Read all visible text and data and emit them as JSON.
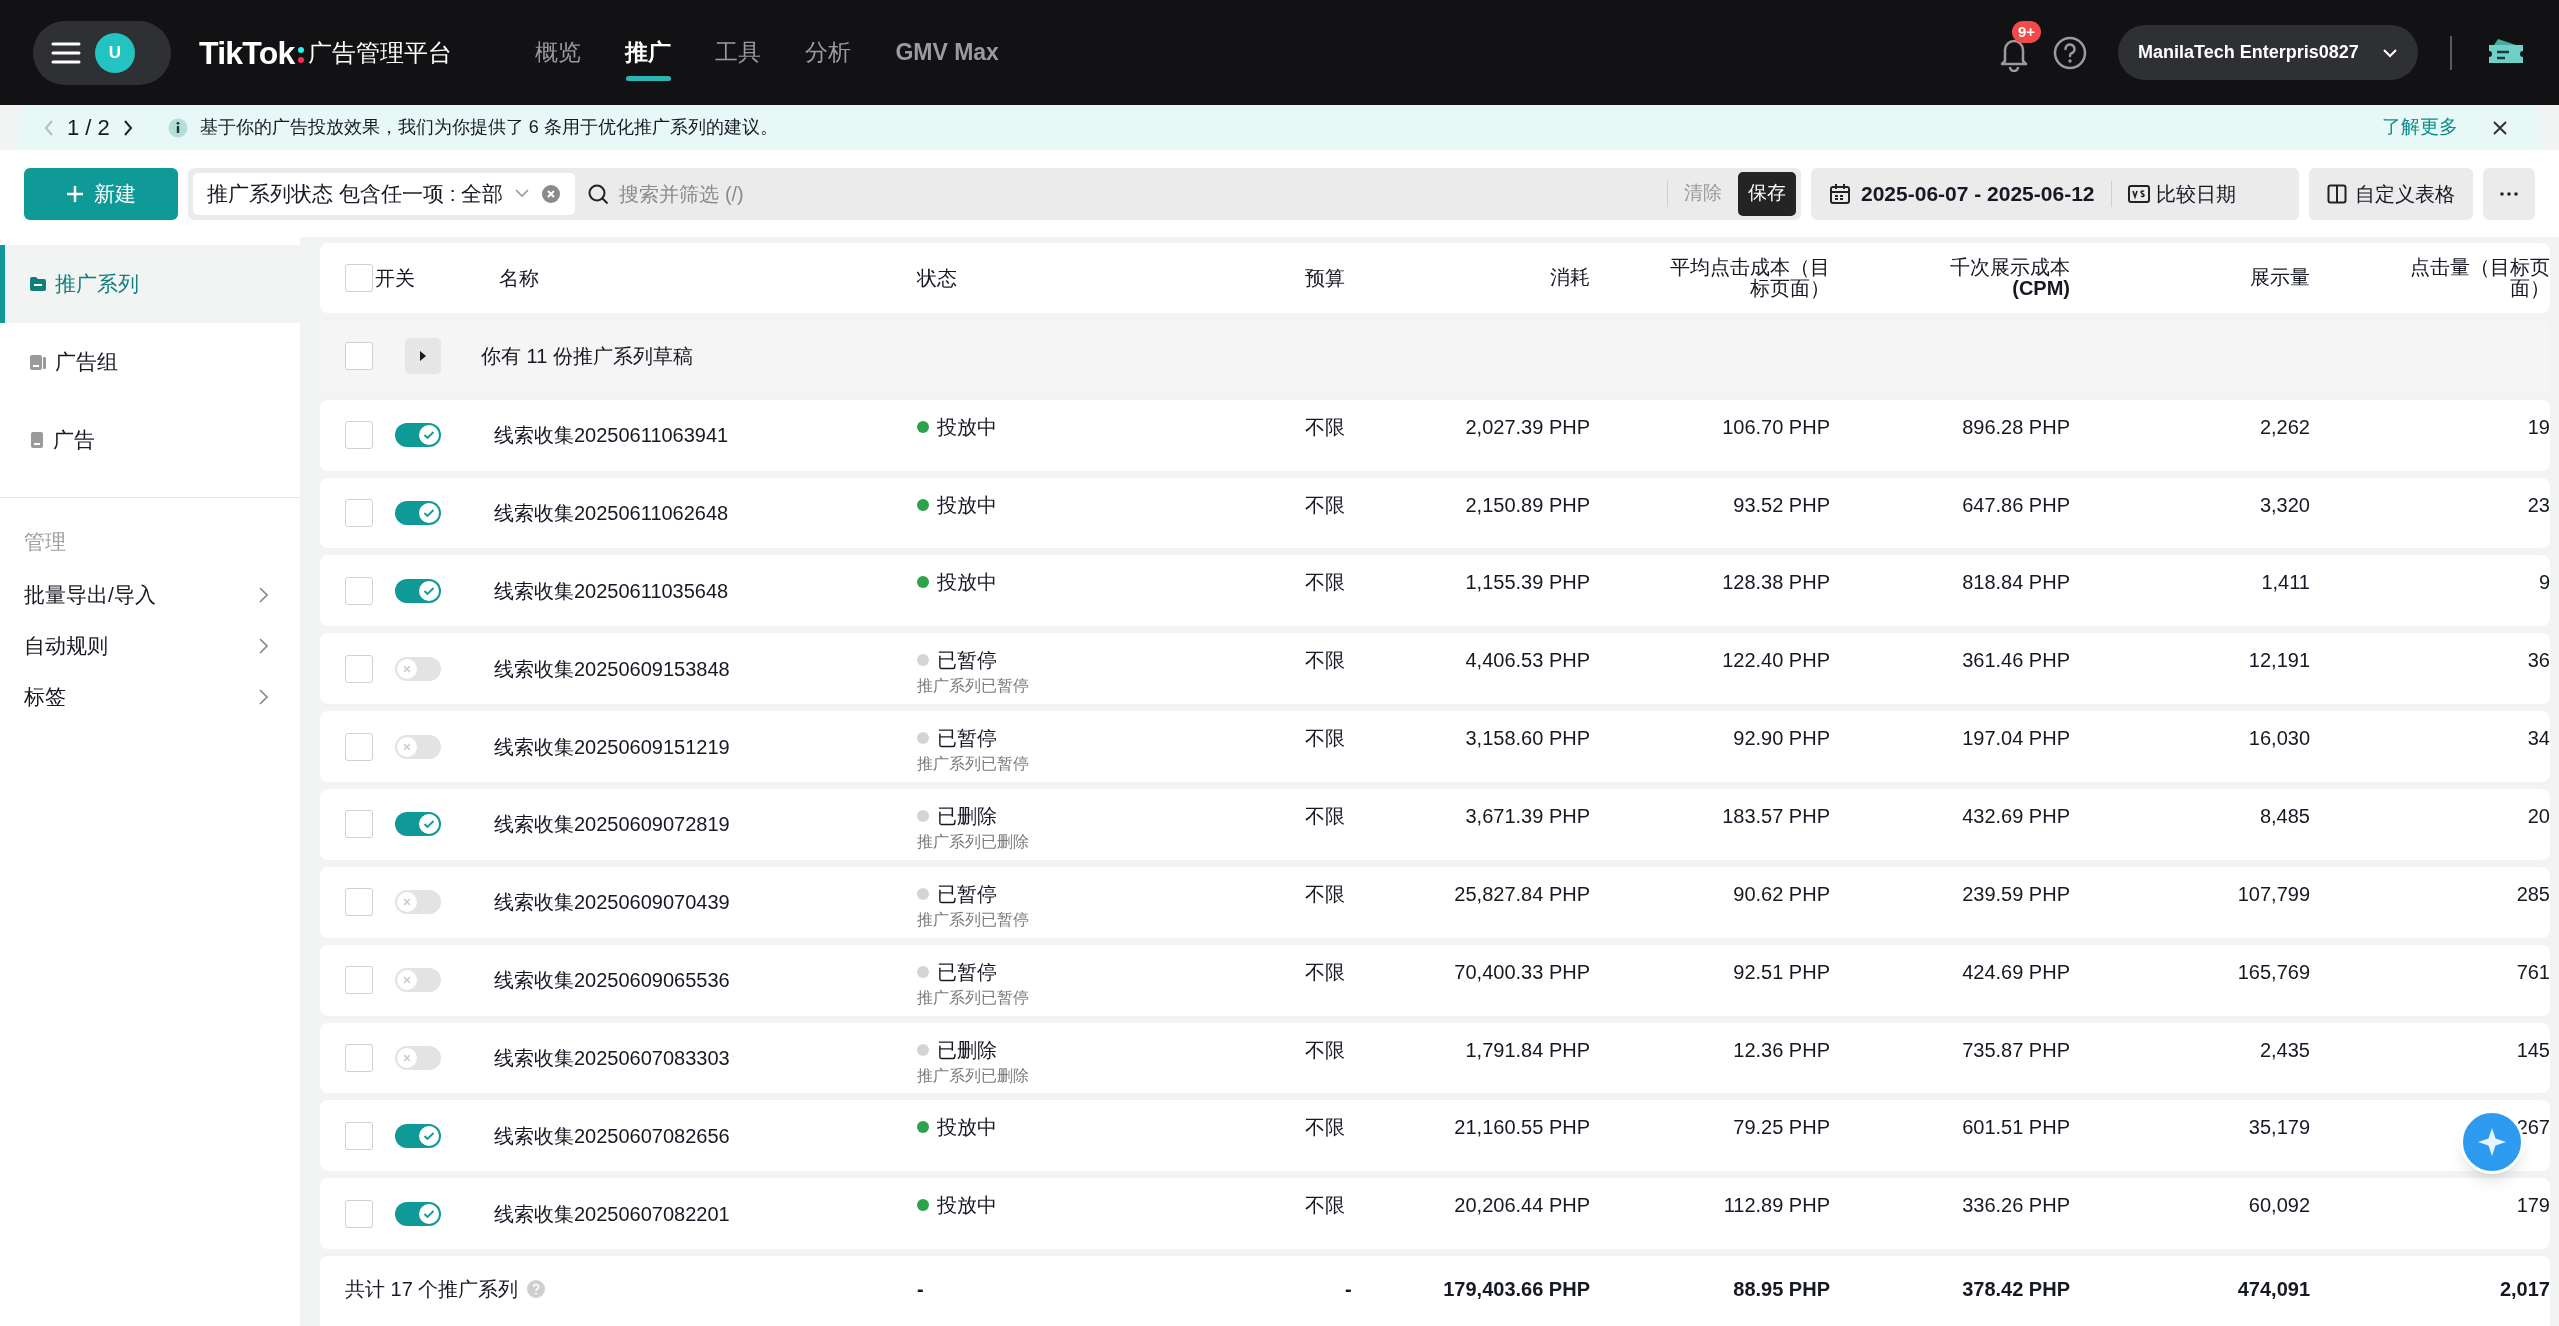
{
  "top_bar": {
    "avatar": "U",
    "logo": "TikTok",
    "logo_suffix": "广告管理平台",
    "nav": [
      {
        "label": "概览",
        "selected": false
      },
      {
        "label": "推广",
        "selected": true
      },
      {
        "label": "工具",
        "selected": false
      },
      {
        "label": "分析",
        "selected": false
      },
      {
        "label": "GMV Max",
        "selected": false
      }
    ],
    "notification_badge": "9+",
    "account": "ManilaTech Enterpris0827"
  },
  "banner": {
    "pager": "1 / 2",
    "message": "基于你的广告投放效果，我们为你提供了 6 条用于优化推广系列的建议。",
    "link": "了解更多"
  },
  "toolbar": {
    "new_button": "新建",
    "filter": "推广系列状态 包含任一项 : 全部",
    "search": {
      "placeholder": "搜索并筛选 (/)"
    },
    "clear": "清除",
    "save": "保存",
    "date_range": "2025-06-07 - 2025-06-12",
    "compare": "比较日期",
    "customize": "自定义表格"
  },
  "sidebar": {
    "items": [
      {
        "label": "推广系列",
        "selected": true
      },
      {
        "label": "广告组",
        "selected": false
      },
      {
        "label": "广告",
        "selected": false
      }
    ],
    "section": "管理",
    "menu": [
      "批量导出/导入",
      "自动规则",
      "标签"
    ]
  },
  "table": {
    "select_all_checked": false,
    "draft_checked": false,
    "columns": [
      "开关",
      "名称",
      "状态",
      "预算",
      "消耗",
      "平均点击成本（目标页面）",
      "千次展示成本 **(CPM)**",
      "展示量",
      "点击量（目标页面）"
    ],
    "draft_row": "你有 11 份推广系列草稿",
    "rows": [
      {
        "checked": false,
        "on": true,
        "name": "线索收集20250611063941",
        "status": "投放中",
        "color": "#2ba34a",
        "budget": "不限",
        "spend": "2,027.39 PHP",
        "cpc": "106.70 PHP",
        "cpm": "896.28 PHP",
        "impressions": "2,262",
        "clicks": "19"
      },
      {
        "checked": false,
        "on": true,
        "name": "线索收集20250611062648",
        "status": "投放中",
        "color": "#2ba34a",
        "budget": "不限",
        "spend": "2,150.89 PHP",
        "cpc": "93.52 PHP",
        "cpm": "647.86 PHP",
        "impressions": "3,320",
        "clicks": "23"
      },
      {
        "checked": false,
        "on": true,
        "name": "线索收集20250611035648",
        "status": "投放中",
        "color": "#2ba34a",
        "budget": "不限",
        "spend": "1,155.39 PHP",
        "cpc": "128.38 PHP",
        "cpm": "818.84 PHP",
        "impressions": "1,411",
        "clicks": "9"
      },
      {
        "checked": false,
        "on": false,
        "name": "线索收集20250609153848",
        "status": "已暂停",
        "color": "#d4d4d4",
        "status_note": "推广系列已暂停",
        "budget": "不限",
        "spend": "4,406.53 PHP",
        "cpc": "122.40 PHP",
        "cpm": "361.46 PHP",
        "impressions": "12,191",
        "clicks": "36"
      },
      {
        "checked": false,
        "on": false,
        "name": "线索收集20250609151219",
        "status": "已暂停",
        "color": "#d4d4d4",
        "status_note": "推广系列已暂停",
        "budget": "不限",
        "spend": "3,158.60 PHP",
        "cpc": "92.90 PHP",
        "cpm": "197.04 PHP",
        "impressions": "16,030",
        "clicks": "34"
      },
      {
        "checked": false,
        "on": true,
        "name": "线索收集20250609072819",
        "status": "已删除",
        "color": "#d4d4d4",
        "status_note": "推广系列已删除",
        "budget": "不限",
        "spend": "3,671.39 PHP",
        "cpc": "183.57 PHP",
        "cpm": "432.69 PHP",
        "impressions": "8,485",
        "clicks": "20"
      },
      {
        "checked": false,
        "on": false,
        "name": "线索收集20250609070439",
        "status": "已暂停",
        "color": "#d4d4d4",
        "status_note": "推广系列已暂停",
        "budget": "不限",
        "spend": "25,827.84 PHP",
        "cpc": "90.62 PHP",
        "cpm": "239.59 PHP",
        "impressions": "107,799",
        "clicks": "285"
      },
      {
        "checked": false,
        "on": false,
        "name": "线索收集20250609065536",
        "status": "已暂停",
        "color": "#d4d4d4",
        "status_note": "推广系列已暂停",
        "budget": "不限",
        "spend": "70,400.33 PHP",
        "cpc": "92.51 PHP",
        "cpm": "424.69 PHP",
        "impressions": "165,769",
        "clicks": "761"
      },
      {
        "checked": false,
        "on": false,
        "name": "线索收集20250607083303",
        "status": "已删除",
        "color": "#d4d4d4",
        "status_note": "推广系列已删除",
        "budget": "不限",
        "spend": "1,791.84 PHP",
        "cpc": "12.36 PHP",
        "cpm": "735.87 PHP",
        "impressions": "2,435",
        "clicks": "145"
      },
      {
        "checked": false,
        "on": true,
        "name": "线索收集20250607082656",
        "status": "投放中",
        "color": "#2ba34a",
        "budget": "不限",
        "spend": "21,160.55 PHP",
        "cpc": "79.25 PHP",
        "cpm": "601.51 PHP",
        "impressions": "35,179",
        "clicks": "267"
      },
      {
        "checked": false,
        "on": true,
        "name": "线索收集20250607082201",
        "status": "投放中",
        "color": "#2ba34a",
        "budget": "不限",
        "spend": "20,206.44 PHP",
        "cpc": "112.89 PHP",
        "cpm": "336.26 PHP",
        "impressions": "60,092",
        "clicks": "179"
      }
    ],
    "footer": {
      "label": "共计 17 个推广系列",
      "status": "-",
      "budget": "-",
      "spend": "179,403.66 PHP",
      "cpc": "88.95 PHP",
      "cpm": "378.42 PHP",
      "impressions": "474,091",
      "clicks": "2,017"
    }
  }
}
